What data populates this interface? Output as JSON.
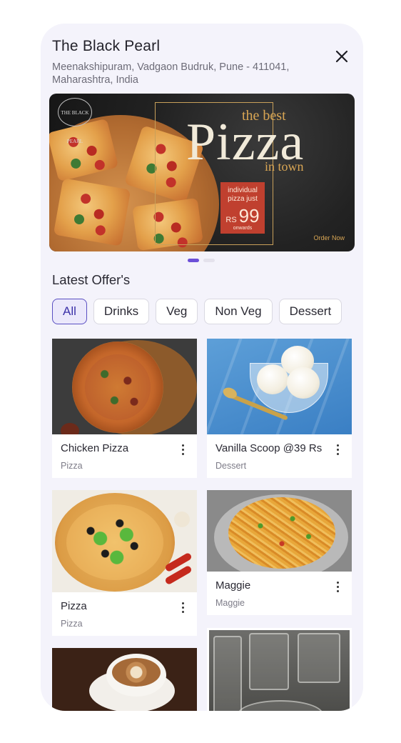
{
  "header": {
    "title": "The Black Pearl",
    "address": "Meenakshipuram, Vadgaon Budruk, Pune - 411041, Maharashtra, India"
  },
  "banner": {
    "logo_text": "THE BLACK PEARL",
    "tagline_top": "the best",
    "headline": "Pizza",
    "tagline_bottom": "in town",
    "offer_line1": "individual",
    "offer_line2": "pizza just",
    "currency": "RS",
    "price": "99",
    "offer_line3": "onwards",
    "cta": "Order Now"
  },
  "carousel": {
    "count": 2,
    "active_index": 0
  },
  "offers": {
    "title": "Latest Offer's",
    "filters": [
      {
        "label": "All",
        "active": true
      },
      {
        "label": "Drinks",
        "active": false
      },
      {
        "label": "Veg",
        "active": false
      },
      {
        "label": "Non Veg",
        "active": false
      },
      {
        "label": "Dessert",
        "active": false
      }
    ],
    "items": [
      {
        "name": "Chicken Pizza",
        "category": "Pizza",
        "image": "pizza-photo"
      },
      {
        "name": "Vanilla Scoop @39 Rs",
        "category": "Dessert",
        "image": "ice-cream-photo"
      },
      {
        "name": "Pizza",
        "category": "Pizza",
        "image": "veg-pizza-photo"
      },
      {
        "name": "Maggie",
        "category": "Maggie",
        "image": "noodles-photo"
      },
      {
        "name": "",
        "category": "",
        "image": "coffee-photo"
      },
      {
        "name": "",
        "category": "",
        "image": "glasses-photo"
      }
    ]
  },
  "colors": {
    "accent": "#6c4fd8",
    "chip_active_bg": "#ebe8fb",
    "chip_active_border": "#5a4fc2",
    "background": "#f4f3fb",
    "banner_price_bg": "#c0402f"
  },
  "icons": {
    "close": "close-icon",
    "more": "kebab-menu-icon"
  }
}
